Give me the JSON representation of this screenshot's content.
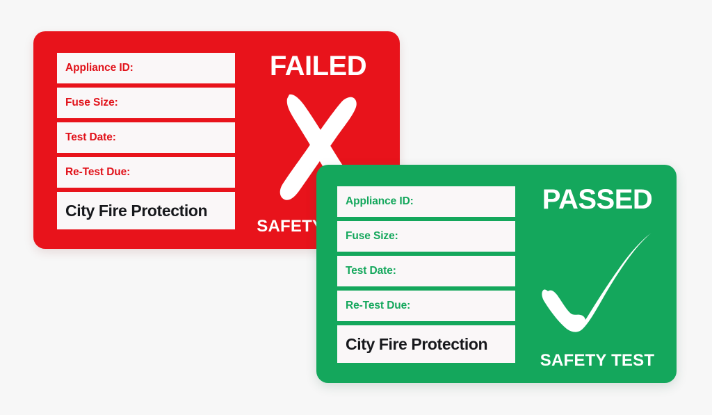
{
  "background_color": "#f7f7f7",
  "labels": [
    {
      "id": "failed-label",
      "status": "FAILED",
      "result_heading": "FAILED",
      "mark_icon": "cross-mark-icon",
      "footer": "SAFETY TEST",
      "accent_color": "#e8131b",
      "field_text_color": "#e1121a",
      "brand": "City Fire Protection",
      "fields": [
        {
          "label": "Appliance ID:",
          "value": ""
        },
        {
          "label": "Fuse Size:",
          "value": ""
        },
        {
          "label": "Test Date:",
          "value": ""
        },
        {
          "label": "Re-Test Due:",
          "value": ""
        }
      ]
    },
    {
      "id": "passed-label",
      "status": "PASSED",
      "result_heading": "PASSED",
      "mark_icon": "check-mark-icon",
      "footer": "SAFETY TEST",
      "accent_color": "#14a75c",
      "field_text_color": "#14a75c",
      "brand": "City Fire Protection",
      "fields": [
        {
          "label": "Appliance ID:",
          "value": ""
        },
        {
          "label": "Fuse Size:",
          "value": ""
        },
        {
          "label": "Test Date:",
          "value": ""
        },
        {
          "label": "Re-Test Due:",
          "value": ""
        }
      ]
    }
  ]
}
